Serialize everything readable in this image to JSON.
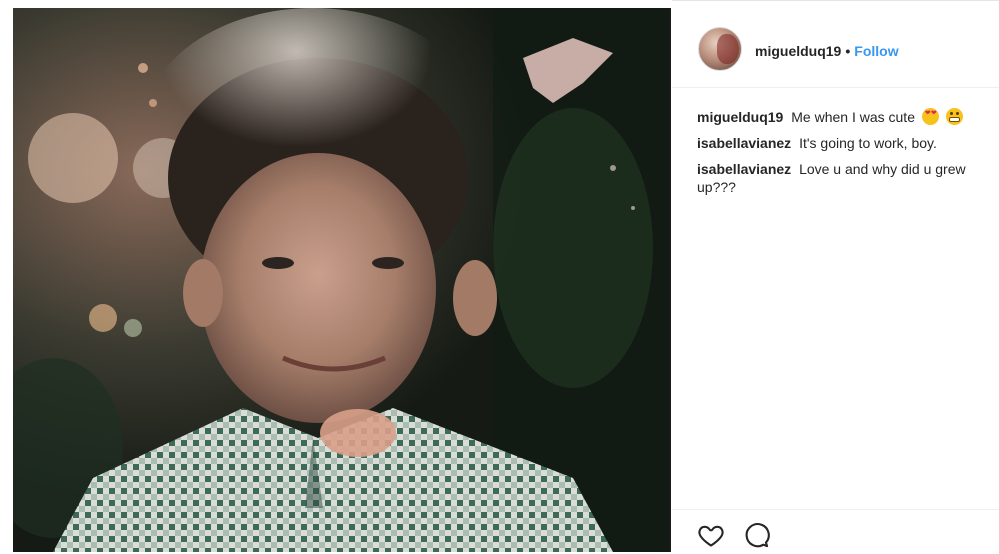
{
  "post": {
    "photo": {
      "icon": "photo-of-child-in-checkered-shirt"
    },
    "header": {
      "username": "miguelduq19",
      "separator": "•",
      "follow_label": "Follow",
      "colors": {
        "follow": "#3897f0",
        "text": "#262626"
      }
    },
    "comments": [
      {
        "user": "miguelduq19",
        "text": "Me when I was cute",
        "emojis": [
          "heart-eyes-emoji",
          "grimacing-face-emoji"
        ]
      },
      {
        "user": "isabellavianez",
        "text": "It's going to work, boy."
      },
      {
        "user": "isabellavianez",
        "text": "Love u and why did u grew up???"
      }
    ],
    "actions": {
      "like_icon": "heart-outline-icon",
      "comment_icon": "speech-bubble-icon"
    }
  }
}
